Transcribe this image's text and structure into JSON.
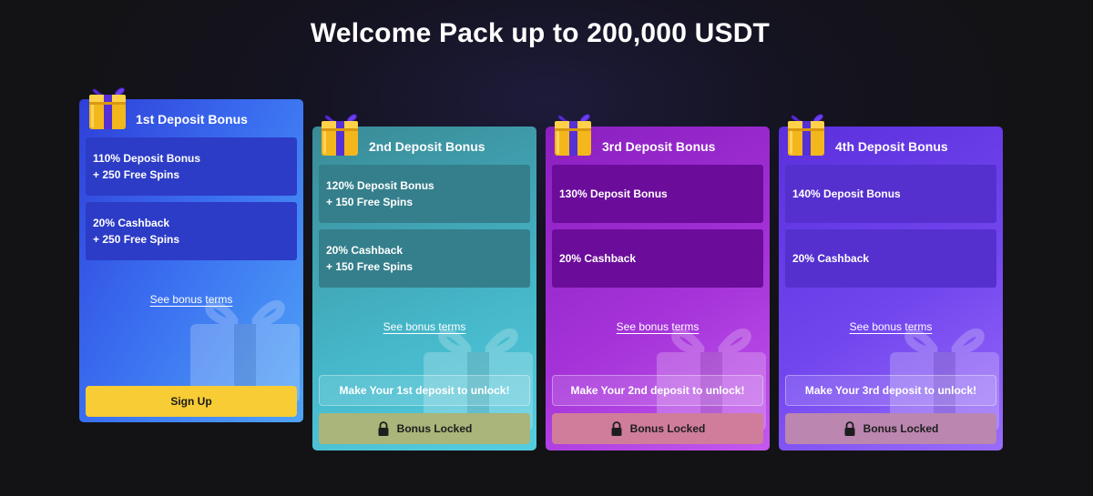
{
  "page": {
    "title": "Welcome Pack up to 200,000 USDT"
  },
  "cards": [
    {
      "title": "1st Deposit Bonus",
      "bonus_a": [
        "110% Deposit Bonus",
        "+ 250 Free Spins"
      ],
      "bonus_b": [
        "20% Cashback",
        "+ 250 Free Spins"
      ],
      "terms_label": "See bonus terms",
      "action_label": "Sign Up"
    },
    {
      "title": "2nd Deposit Bonus",
      "bonus_a": [
        "120% Deposit Bonus",
        "+ 150 Free Spins"
      ],
      "bonus_b": [
        "20% Cashback",
        "+ 150 Free Spins"
      ],
      "terms_label": "See bonus terms",
      "unlock_label": "Make Your 1st deposit to unlock!",
      "locked_label": "Bonus Locked"
    },
    {
      "title": "3rd Deposit Bonus",
      "bonus_a": [
        "130% Deposit Bonus"
      ],
      "bonus_b": [
        "20% Cashback"
      ],
      "terms_label": "See bonus terms",
      "unlock_label": "Make Your 2nd deposit to unlock!",
      "locked_label": "Bonus Locked"
    },
    {
      "title": "4th Deposit Bonus",
      "bonus_a": [
        "140% Deposit Bonus"
      ],
      "bonus_b": [
        "20% Cashback"
      ],
      "terms_label": "See bonus terms",
      "unlock_label": "Make Your 3rd deposit to unlock!",
      "locked_label": "Bonus Locked"
    }
  ],
  "icons": {
    "gift": "gift-icon",
    "lock": "lock-icon"
  },
  "colors": {
    "signup": "#f7cc34",
    "background": "#131316"
  }
}
